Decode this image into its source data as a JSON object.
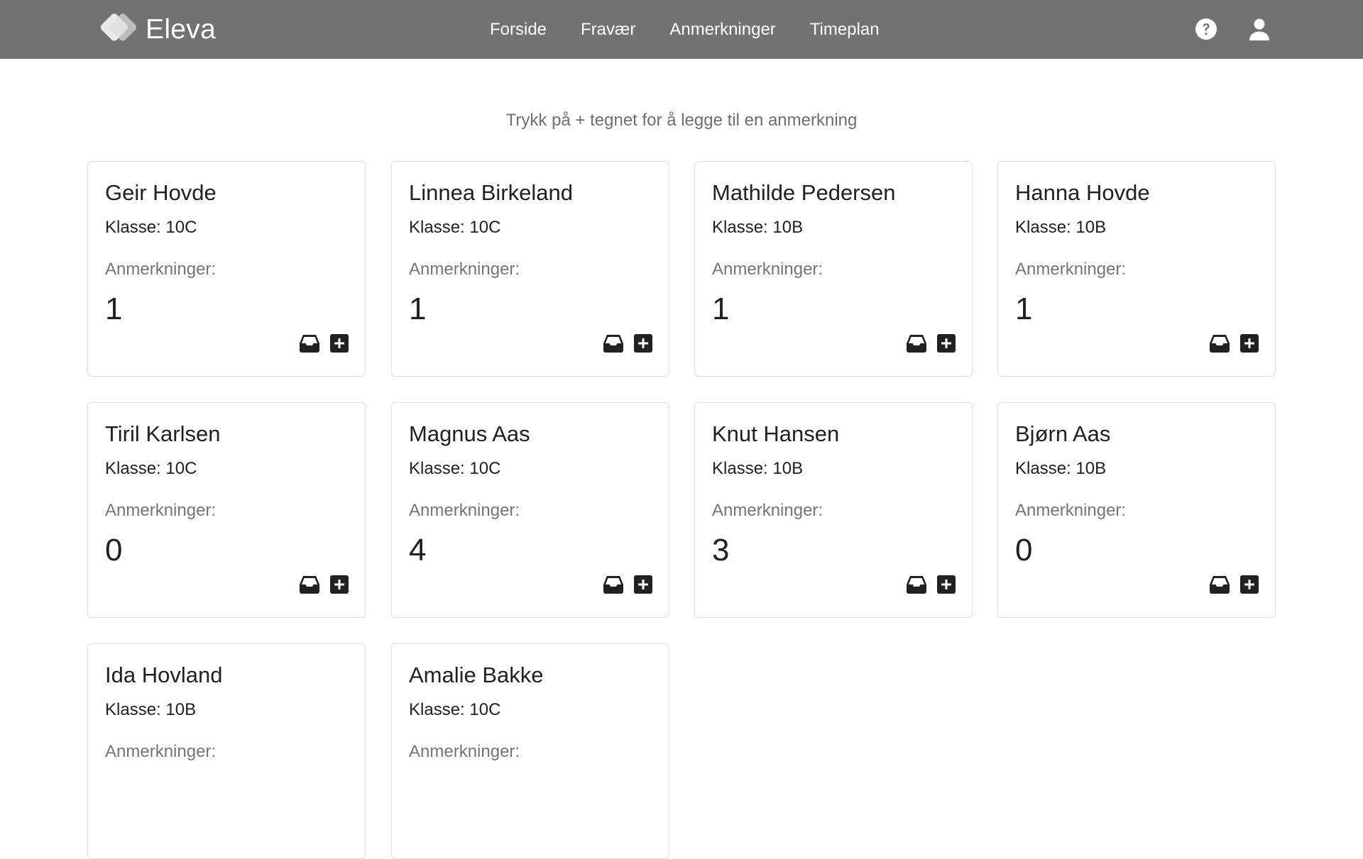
{
  "app": {
    "name": "Eleva"
  },
  "nav": {
    "links": [
      "Forside",
      "Fravær",
      "Anmerkninger",
      "Timeplan"
    ]
  },
  "hint": "Trykk på + tegnet for å legge til en anmerkning",
  "students": [
    {
      "name": "Geir Hovde",
      "class": "Klasse: 10C",
      "label": "Anmerkninger:",
      "count": "1"
    },
    {
      "name": "Linnea Birkeland",
      "class": "Klasse: 10C",
      "label": "Anmerkninger:",
      "count": "1"
    },
    {
      "name": "Mathilde Pedersen",
      "class": "Klasse: 10B",
      "label": "Anmerkninger:",
      "count": "1"
    },
    {
      "name": "Hanna Hovde",
      "class": "Klasse: 10B",
      "label": "Anmerkninger:",
      "count": "1"
    },
    {
      "name": "Tiril Karlsen",
      "class": "Klasse: 10C",
      "label": "Anmerkninger:",
      "count": "0"
    },
    {
      "name": "Magnus Aas",
      "class": "Klasse: 10C",
      "label": "Anmerkninger:",
      "count": "4"
    },
    {
      "name": "Knut Hansen",
      "class": "Klasse: 10B",
      "label": "Anmerkninger:",
      "count": "3"
    },
    {
      "name": "Bjørn Aas",
      "class": "Klasse: 10B",
      "label": "Anmerkninger:",
      "count": "0"
    },
    {
      "name": "Ida Hovland",
      "class": "Klasse: 10B",
      "label": "Anmerkninger:",
      "count": ""
    },
    {
      "name": "Amalie Bakke",
      "class": "Klasse: 10C",
      "label": "Anmerkninger:",
      "count": ""
    }
  ],
  "icons": {
    "logo": "eleva-logo",
    "help": "help-icon",
    "user": "user-icon",
    "inbox": "inbox-icon",
    "add": "plus-square-icon"
  },
  "colors": {
    "navbar": "#727272",
    "card_border": "#dedede",
    "muted_text": "#757575",
    "icon": "#212121"
  }
}
